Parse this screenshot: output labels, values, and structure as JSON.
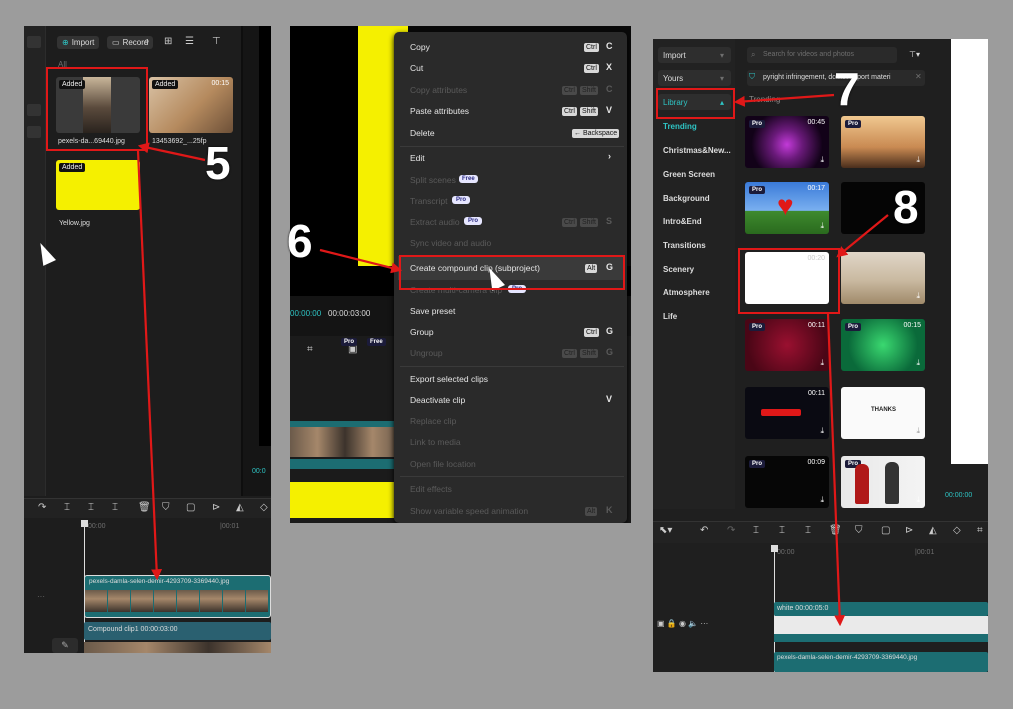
{
  "panel1": {
    "toolbar": {
      "import": "Import",
      "record": "Record"
    },
    "filter_label": "All",
    "media": [
      {
        "badge": "Added",
        "name": "pexels-da...69440.jpg"
      },
      {
        "badge": "Added",
        "duration": "00:15",
        "name": "13453692_...25fp"
      },
      {
        "badge": "Added",
        "name": "Yellow.jpg"
      }
    ],
    "ruler": {
      "t0": "00:00",
      "t1": "|00:01"
    },
    "clip_name": "pexels-damla-selen-demir-4293709-3369440.jpg",
    "compound": {
      "name": "Compound clip1",
      "time": "00:00:03:00"
    },
    "timecode": "00:0"
  },
  "panel2": {
    "timecode": {
      "current": "00:00:00",
      "total": "00:00:03:00"
    },
    "badges": {
      "pro": "Pro",
      "free": "Free"
    },
    "menu": [
      {
        "label": "Copy",
        "keys": [
          "Ctrl"
        ],
        "letter": "C",
        "enabled": true
      },
      {
        "label": "Cut",
        "keys": [
          "Ctrl"
        ],
        "letter": "X",
        "enabled": true
      },
      {
        "label": "Copy attributes",
        "keys": [
          "Ctrl",
          "Shift"
        ],
        "letter": "C",
        "enabled": false
      },
      {
        "label": "Paste attributes",
        "keys": [
          "Ctrl",
          "Shift"
        ],
        "letter": "V",
        "enabled": true
      },
      {
        "label": "Delete",
        "keys": [
          "← Backspace"
        ],
        "letter": "",
        "enabled": true
      },
      {
        "label": "Edit",
        "keys": [],
        "letter": "›",
        "enabled": true
      },
      {
        "label": "Split scenes",
        "badge": "Free",
        "enabled": false
      },
      {
        "label": "Transcript",
        "badge": "Pro",
        "enabled": false
      },
      {
        "label": "Extract audio",
        "badge": "Pro",
        "keys": [
          "Ctrl",
          "Shift"
        ],
        "letter": "S",
        "enabled": false
      },
      {
        "label": "Sync video and audio",
        "enabled": false
      },
      {
        "label": "Create compound clip (subproject)",
        "keys": [
          "Alt"
        ],
        "letter": "G",
        "enabled": true
      },
      {
        "label": "Create multi-camera clip",
        "badge": "Pro",
        "enabled": false
      },
      {
        "label": "Save preset",
        "enabled": true
      },
      {
        "label": "Group",
        "keys": [
          "Ctrl"
        ],
        "letter": "G",
        "enabled": true
      },
      {
        "label": "Ungroup",
        "keys": [
          "Ctrl",
          "Shift"
        ],
        "letter": "G",
        "enabled": false
      },
      {
        "label": "Export selected clips",
        "enabled": true
      },
      {
        "label": "Deactivate clip",
        "letter": "V",
        "enabled": true
      },
      {
        "label": "Replace clip",
        "enabled": false
      },
      {
        "label": "Link to media",
        "enabled": false
      },
      {
        "label": "Open file location",
        "enabled": false
      },
      {
        "label": "Edit effects",
        "enabled": false
      },
      {
        "label": "Show variable speed animation",
        "keys": [
          "Alt"
        ],
        "letter": "K",
        "enabled": false
      }
    ]
  },
  "panel3": {
    "sidebar": {
      "import": "Import",
      "yours": "Yours",
      "library": "Library",
      "items": [
        "Trending",
        "Christmas&New...",
        "Green Screen",
        "Background",
        "Intro&End",
        "Transitions",
        "Scenery",
        "Atmosphere",
        "Life"
      ]
    },
    "search_placeholder": "Search for videos and photos",
    "notice": "pyright infringement, do not import materi",
    "section": "Trending",
    "grid": [
      {
        "pro": true,
        "dur": "00:45"
      },
      {
        "pro": true,
        "dur": ""
      },
      {
        "pro": true,
        "dur": "00:17"
      },
      {
        "pro": false,
        "dur": ""
      },
      {
        "pro": false,
        "dur": "00:20"
      },
      {
        "pro": false,
        "dur": ""
      },
      {
        "pro": true,
        "dur": "00:11"
      },
      {
        "pro": true,
        "dur": "00:15"
      },
      {
        "pro": false,
        "dur": "00:11"
      },
      {
        "pro": false,
        "dur": ""
      },
      {
        "pro": true,
        "dur": "00:09"
      },
      {
        "pro": true,
        "dur": ""
      }
    ],
    "thanks_text": "THANKS",
    "ruler": {
      "t0": "00:00",
      "t1": "|00:01"
    },
    "white_clip": {
      "name": "white",
      "time": "00:00:05:0"
    },
    "clip_name": "pexels-damla-selen-demir-4293709-3369440.jpg",
    "timecode": "00:00:00"
  },
  "annotations": {
    "n5": "5",
    "n6": "6",
    "n7": "7",
    "n8": "8"
  },
  "colors": {
    "accent": "#2ec4c4",
    "highlight_red": "#e01818",
    "yellow": "#f5f000",
    "track_teal": "#1c6d72"
  }
}
